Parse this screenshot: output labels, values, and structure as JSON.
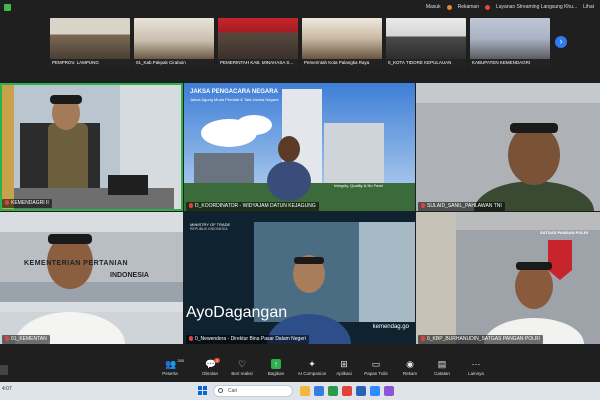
{
  "topbar": {
    "signal_label": "Masuk",
    "rec_label": "Rekaman",
    "stream_label": "Layanan Streaming Langsung Khu...",
    "view_label": "Lihat"
  },
  "strip": {
    "thumbs": [
      "PEMPROV. LAMPUNG",
      "01_Kab.Pakpak Ciraboin",
      "PEMERINTAH KAB. MINAHASA S...",
      "Pemerintah Kota Palangka Raya",
      "0_KOTA TIDORE KEPULAUAN",
      "KABUPATEN KEMENDAGRI"
    ]
  },
  "tiles": [
    {
      "name": "KEMENDAGRI II"
    },
    {
      "name": "D_KOORDINATOR - WIDYAJAM DATUN KEJAGUNG",
      "banner_title": "JAKSA PENGACARA NEGARA",
      "banner_sub": "Jaksa Agung Muda Perdata & Tata Usaha Negara",
      "tagline": "Integrity, Quality & No Fear!"
    },
    {
      "name": "SULAID_SANIL_PAHLAWAN TNI"
    },
    {
      "name": "01_KEMENTAN",
      "building_text1": "KEMENTERIAN PERTANIAN",
      "building_text2": "INDONESIA"
    },
    {
      "name": "0_Newendera - Direktur Bina Pasar Dalam Negeri",
      "logo_text": "MINISTRY OF TRADE",
      "logo_sub": "REPUBLIK INDONESIA",
      "big_text": "AyoDagangan",
      "corner_text": "kemendag.go"
    },
    {
      "name": "0_KBP_BURHANUDIN_SATGAS PANGAN POLRI",
      "badge_text": "SATGAS PANGAN POLRI"
    }
  ],
  "toolbar": {
    "items": [
      {
        "label": "Peserta",
        "count": "285",
        "icon": "people-icon"
      },
      {
        "label": "Obrolan",
        "count": "3",
        "icon": "chat-icon"
      },
      {
        "label": "Beri reaksi",
        "icon": "heart-icon"
      },
      {
        "label": "Bagikan",
        "icon": "share-icon"
      },
      {
        "label": "AI Companion",
        "icon": "sparkle-icon"
      },
      {
        "label": "Aplikasi",
        "icon": "apps-icon"
      },
      {
        "label": "Papan Tulis",
        "icon": "whiteboard-icon"
      },
      {
        "label": "Rekam",
        "icon": "record-icon"
      },
      {
        "label": "Catatan",
        "icon": "notes-icon"
      },
      {
        "label": "Lainnya",
        "icon": "more-icon"
      }
    ]
  },
  "taskbar": {
    "search_placeholder": "Cari",
    "clock": "4:07"
  },
  "colors": {
    "active_border": "#2bb24c",
    "accent_blue": "#2f7bf0",
    "mute_red": "#e0433a"
  }
}
